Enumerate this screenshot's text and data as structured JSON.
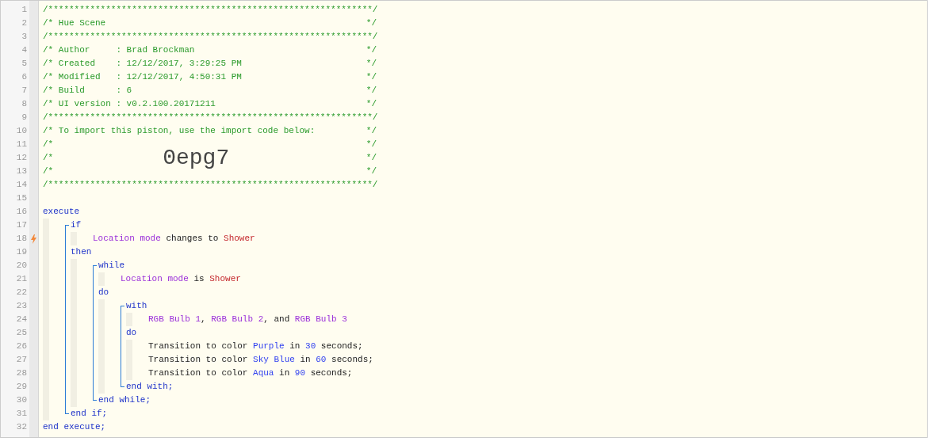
{
  "header": [
    {
      "number": "1",
      "text": "/**************************************************************/"
    },
    {
      "number": "2",
      "text": "/* Hue Scene",
      "close": "*/"
    },
    {
      "number": "3",
      "text": "/**************************************************************/"
    },
    {
      "number": "4",
      "text": "/* Author     : Brad Brockman",
      "close": "*/"
    },
    {
      "number": "5",
      "text": "/* Created    : 12/12/2017, 3:29:25 PM",
      "close": "*/"
    },
    {
      "number": "6",
      "text": "/* Modified   : 12/12/2017, 4:50:31 PM",
      "close": "*/"
    },
    {
      "number": "7",
      "text": "/* Build      : 6",
      "close": "*/"
    },
    {
      "number": "8",
      "text": "/* UI version : v0.2.100.20171211",
      "close": "*/"
    },
    {
      "number": "9",
      "text": "/**************************************************************/"
    },
    {
      "number": "10",
      "text": "/* To import this piston, use the import code below:",
      "close": "*/"
    },
    {
      "number": "11",
      "text": "/*",
      "close": "*/"
    },
    {
      "number": "12",
      "text": "/*",
      "code": "0epg7",
      "close": "*/"
    },
    {
      "number": "13",
      "text": "/*",
      "close": "*/"
    },
    {
      "number": "14",
      "text": "/**************************************************************/"
    },
    {
      "number": "15"
    }
  ],
  "program": {
    "bracket": false,
    "sections": [
      {
        "line": {
          "number": "16",
          "tokens": [
            {
              "text": "execute",
              "kind": "keyword"
            }
          ]
        },
        "children": [
          {
            "bracket": true,
            "sections": [
              {
                "line": {
                  "number": "17",
                  "tokens": [
                    {
                      "text": "if",
                      "kind": "keyword"
                    }
                  ]
                },
                "children": [
                  {
                    "line": {
                      "number": "18",
                      "trigger": true,
                      "tokens": [
                        {
                          "text": "Location mode",
                          "kind": "device"
                        },
                        {
                          "text": " changes to ",
                          "kind": "plain"
                        },
                        {
                          "text": "Shower",
                          "kind": "value"
                        }
                      ]
                    }
                  }
                ]
              },
              {
                "line": {
                  "number": "19",
                  "tokens": [
                    {
                      "text": "then",
                      "kind": "keyword"
                    }
                  ]
                },
                "children": [
                  {
                    "bracket": true,
                    "sections": [
                      {
                        "line": {
                          "number": "20",
                          "tokens": [
                            {
                              "text": "while",
                              "kind": "keyword"
                            }
                          ]
                        },
                        "children": [
                          {
                            "line": {
                              "number": "21",
                              "trigger": false,
                              "tokens": [
                                {
                                  "text": "Location mode",
                                  "kind": "device"
                                },
                                {
                                  "text": " is ",
                                  "kind": "plain"
                                },
                                {
                                  "text": "Shower",
                                  "kind": "value"
                                }
                              ]
                            }
                          }
                        ]
                      },
                      {
                        "line": {
                          "number": "22",
                          "tokens": [
                            {
                              "text": "do",
                              "kind": "keyword"
                            }
                          ]
                        },
                        "children": [
                          {
                            "bracket": true,
                            "sections": [
                              {
                                "line": {
                                  "number": "23",
                                  "tokens": [
                                    {
                                      "text": "with",
                                      "kind": "keyword"
                                    }
                                  ]
                                },
                                "children": [
                                  {
                                    "line": {
                                      "number": "24",
                                      "trigger": false,
                                      "tokens": [
                                        {
                                          "text": "RGB Bulb 1",
                                          "kind": "device"
                                        },
                                        {
                                          "text": ", ",
                                          "kind": "plain"
                                        },
                                        {
                                          "text": "RGB Bulb 2",
                                          "kind": "device"
                                        },
                                        {
                                          "text": ", and ",
                                          "kind": "plain"
                                        },
                                        {
                                          "text": "RGB Bulb 3",
                                          "kind": "device"
                                        }
                                      ]
                                    }
                                  }
                                ]
                              },
                              {
                                "line": {
                                  "number": "25",
                                  "tokens": [
                                    {
                                      "text": "do",
                                      "kind": "keyword"
                                    }
                                  ]
                                },
                                "children": [
                                  {
                                    "line": {
                                      "number": "26",
                                      "trigger": false,
                                      "tokens": [
                                        {
                                          "text": "Transition to color ",
                                          "kind": "plain"
                                        },
                                        {
                                          "text": "Purple",
                                          "kind": "literal"
                                        },
                                        {
                                          "text": " in ",
                                          "kind": "plain"
                                        },
                                        {
                                          "text": "30",
                                          "kind": "literal"
                                        },
                                        {
                                          "text": " seconds;",
                                          "kind": "plain"
                                        }
                                      ]
                                    }
                                  },
                                  {
                                    "line": {
                                      "number": "27",
                                      "trigger": false,
                                      "tokens": [
                                        {
                                          "text": "Transition to color ",
                                          "kind": "plain"
                                        },
                                        {
                                          "text": "Sky Blue",
                                          "kind": "literal"
                                        },
                                        {
                                          "text": " in ",
                                          "kind": "plain"
                                        },
                                        {
                                          "text": "60",
                                          "kind": "literal"
                                        },
                                        {
                                          "text": " seconds;",
                                          "kind": "plain"
                                        }
                                      ]
                                    }
                                  },
                                  {
                                    "line": {
                                      "number": "28",
                                      "trigger": false,
                                      "tokens": [
                                        {
                                          "text": "Transition to color ",
                                          "kind": "plain"
                                        },
                                        {
                                          "text": "Aqua",
                                          "kind": "literal"
                                        },
                                        {
                                          "text": " in ",
                                          "kind": "plain"
                                        },
                                        {
                                          "text": "90",
                                          "kind": "literal"
                                        },
                                        {
                                          "text": " seconds;",
                                          "kind": "plain"
                                        }
                                      ]
                                    }
                                  }
                                ]
                              }
                            ],
                            "end": {
                              "number": "29",
                              "tokens": [
                                {
                                  "text": "end with;",
                                  "kind": "keyword"
                                }
                              ]
                            }
                          }
                        ]
                      }
                    ],
                    "end": {
                      "number": "30",
                      "tokens": [
                        {
                          "text": "end while;",
                          "kind": "keyword"
                        }
                      ]
                    }
                  }
                ]
              }
            ],
            "end": {
              "number": "31",
              "tokens": [
                {
                  "text": "end if;",
                  "kind": "keyword"
                }
              ]
            }
          }
        ]
      }
    ],
    "end": {
      "number": "32",
      "tokens": [
        {
          "text": "end execute;",
          "kind": "keyword"
        }
      ]
    }
  }
}
